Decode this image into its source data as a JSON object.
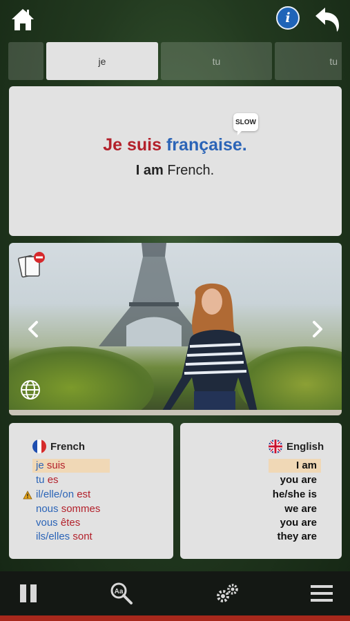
{
  "tabs": [
    {
      "label": ""
    },
    {
      "label": "je"
    },
    {
      "label": "tu"
    },
    {
      "label": "tu"
    }
  ],
  "phrase": {
    "fr_pronoun": "Je suis",
    "fr_rest": "française.",
    "en_bold": "I am",
    "en_rest": "French.",
    "slow_label": "SLOW"
  },
  "conjugation": {
    "french": {
      "title": "French",
      "rows": [
        {
          "pronoun": "je",
          "verb": "suis"
        },
        {
          "pronoun": "tu",
          "verb": "es"
        },
        {
          "pronoun": "il/elle/on",
          "verb": "est"
        },
        {
          "pronoun": "nous",
          "verb": "sommes"
        },
        {
          "pronoun": "vous",
          "verb": "êtes"
        },
        {
          "pronoun": "ils/elles",
          "verb": "sont"
        }
      ]
    },
    "english": {
      "title": "English",
      "rows": [
        "I am",
        "you are",
        "he/she is",
        "we are",
        "you are",
        "they are"
      ]
    }
  },
  "colors": {
    "pronoun": "#2b64b7",
    "verb": "#b3212b",
    "highlight": "#f0d8b6",
    "info": "#1f64b8",
    "bottom_strip": "#a8281c"
  },
  "icons": {
    "top": [
      "home-icon",
      "info-icon",
      "back-arrow-icon"
    ],
    "photo": [
      "flashcards-remove-icon",
      "chevron-left-icon",
      "chevron-right-icon",
      "globe-icon"
    ],
    "bottom": [
      "pause-icon",
      "dictionary-search-icon",
      "settings-gears-icon",
      "menu-icon"
    ]
  },
  "info_glyph": "i"
}
